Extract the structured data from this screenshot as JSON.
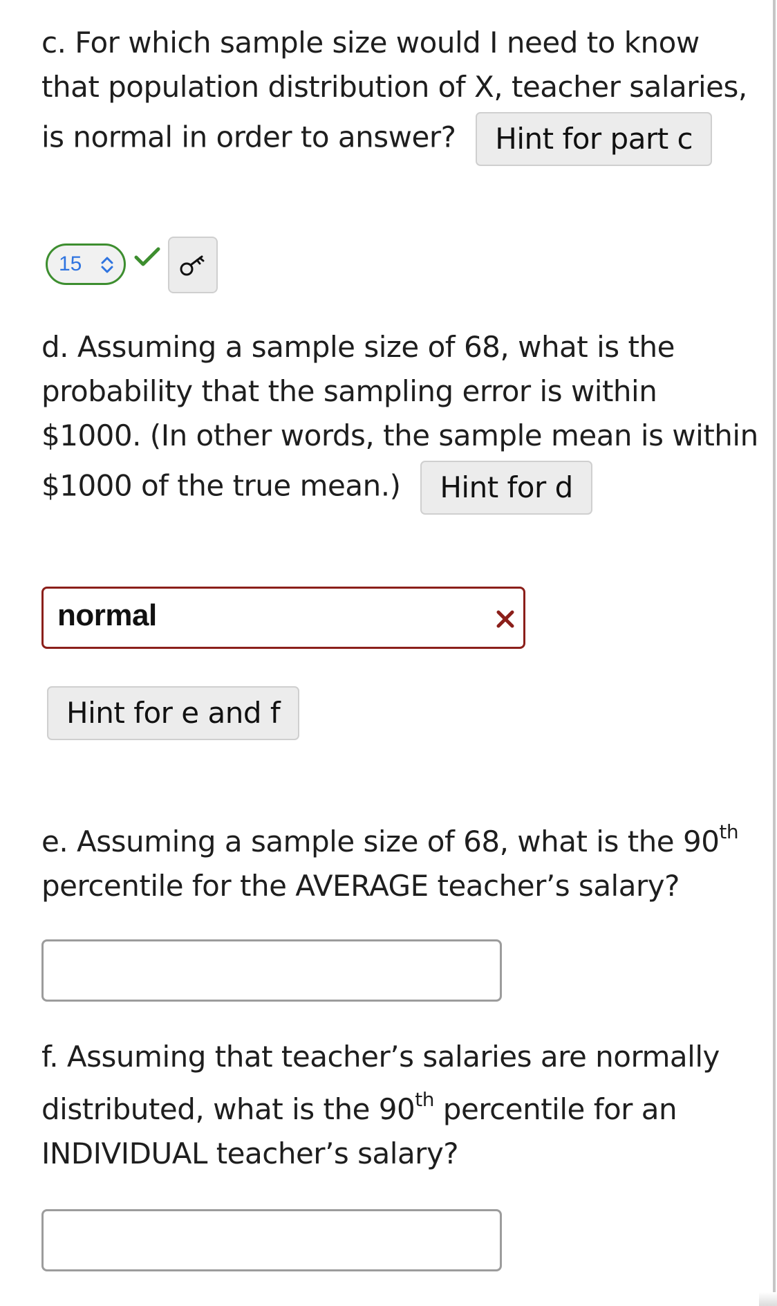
{
  "part_c": {
    "line1": "c. For which sample size would I need to know",
    "line2": "that population distribution of X, teacher salaries,",
    "line3": "is normal in order to answer?",
    "hint_label": "Hint for part c",
    "answer": {
      "selected_value": "15",
      "status": "correct",
      "status_icon": "checkmark-icon",
      "key_icon": "key-icon",
      "colors": {
        "correct": "#3d8e2f",
        "value": "#2f74e0"
      }
    }
  },
  "part_d": {
    "line1": "d. Assuming a sample size of 68, what is the",
    "line2": "probability that the sampling error is within",
    "line3": "$1000. (In other words, the sample mean is within",
    "line4": "$1000 of the true mean.)",
    "hint_label": "Hint for d",
    "answer": {
      "value": "normal",
      "status": "incorrect",
      "status_icon": "x-icon",
      "colors": {
        "incorrect": "#8b1f1a"
      }
    }
  },
  "hint_ef": {
    "label": "Hint for e and f"
  },
  "part_e": {
    "line1_pre": "e. Assuming a sample size of 68, what is the 90",
    "line1_sup": "th",
    "line2": "percentile for the AVERAGE teacher’s salary?",
    "answer": {
      "value": ""
    }
  },
  "part_f": {
    "line1": "f. Assuming that teacher’s salaries are normally",
    "line2_pre": "distributed, what is the 90",
    "line2_sup": "th",
    "line2_post": " percentile for an",
    "line3": "INDIVIDUAL teacher’s salary?",
    "answer": {
      "value": ""
    }
  }
}
